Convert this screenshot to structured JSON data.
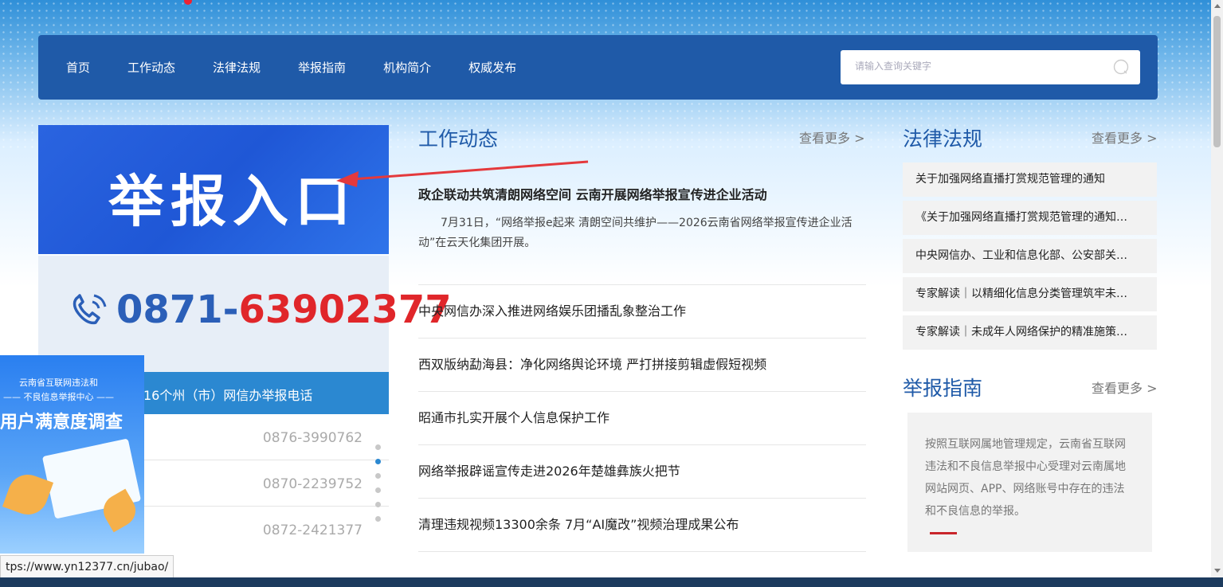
{
  "nav": {
    "items": [
      "首页",
      "工作动态",
      "法律法规",
      "举报指南",
      "机构简介",
      "权威发布"
    ],
    "search_placeholder": "请输入查询关键字"
  },
  "banner": {
    "text": "举报入口"
  },
  "hotline": {
    "prefix": "0871-",
    "number": "63902377"
  },
  "prefecture": {
    "title": "16个州（市）网信办举报电话",
    "phones": [
      "0876-3990762",
      "0870-2239752",
      "0872-2421377"
    ]
  },
  "survey": {
    "line1": "云南省互联网违法和",
    "line2": "—— 不良信息举报中心 ——",
    "title": "用户满意度调查"
  },
  "status_url": "tps://www.yn12377.cn/jubao/",
  "work": {
    "title": "工作动态",
    "more": "查看更多 >",
    "lead_title": "政企联动共筑清朗网络空间 云南开展网络举报宣传进企业活动",
    "lead_desc": "7月31日，“网络举报e起来 清朗空间共维护——2026云南省网络举报宣传进企业活动”在云天化集团开展。",
    "items": [
      "中央网信办深入推进网络娱乐团播乱象整治工作",
      "西双版纳勐海县：净化网络舆论环境 严打拼接剪辑虚假短视频",
      "昭通市扎实开展个人信息保护工作",
      "网络举报辟谣宣传走进2026年楚雄彝族火把节",
      "清理违规视频13300余条 7月“AI魔改”视频治理成果公布"
    ]
  },
  "law": {
    "title": "法律法规",
    "more": "查看更多 >",
    "items": [
      "关于加强网络直播打赏规范管理的通知",
      "《关于加强网络直播打赏规范管理的通知…",
      "中央网信办、工业和信息化部、公安部关…",
      "专家解读｜以精细化信息分类管理筑牢未…",
      "专家解读｜未成年人网络保护的精准施策…"
    ]
  },
  "guide": {
    "title": "举报指南",
    "more": "查看更多 >",
    "text": "按照互联网属地管理规定，云南省互联网违法和不良信息举报中心受理对云南属地网站网页、APP、网络账号中存在的违法和不良信息的举报。"
  },
  "colors": {
    "nav_bg": "#1f5aa8",
    "accent": "#2b88d1",
    "red": "#e0262a"
  }
}
